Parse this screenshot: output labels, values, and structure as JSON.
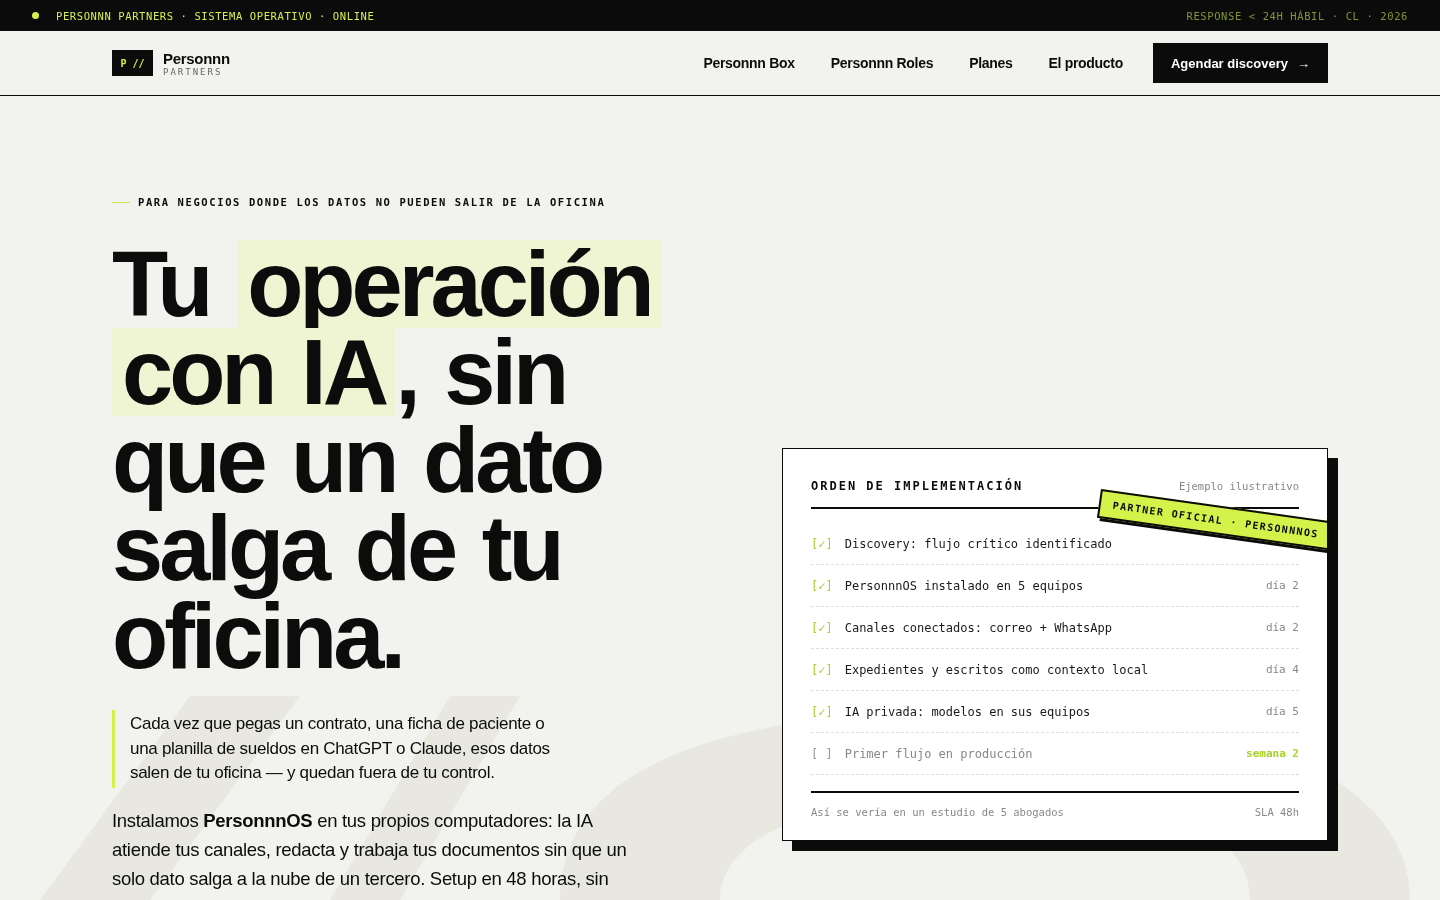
{
  "status_bar": {
    "online": true,
    "left": "PERSONNN PARTNERS · SISTEMA OPERATIVO · ONLINE",
    "right": "RESPONSE < 24H HÁBIL · CL · 2026"
  },
  "nav": {
    "logo_mark": "P //",
    "logo_name": "Personnn",
    "logo_sub": "PARTNERS",
    "links": [
      "Personnn Box",
      "Personnn Roles",
      "Planes",
      "El producto"
    ],
    "cta": {
      "label": "Agendar discovery",
      "arrow": "→"
    }
  },
  "hero": {
    "eyebrow": "PARA NEGOCIOS DONDE LOS DATOS NO PUEDEN SALIR DE LA OFICINA",
    "headline": [
      [
        {
          "text": "Tu ",
          "highlighted": false
        },
        {
          "text": "operación",
          "highlighted": true
        }
      ],
      [
        {
          "text": "con IA",
          "highlighted": true
        },
        {
          "text": ", sin",
          "highlighted": false
        }
      ],
      [
        {
          "text": "que un dato",
          "highlighted": false
        }
      ],
      [
        {
          "text": "salga de tu",
          "highlighted": false
        }
      ],
      [
        {
          "text": "oficina.",
          "highlighted": false
        }
      ]
    ],
    "quote": "Cada vez que pegas un contrato, una ficha de paciente o una planilla de sueldos en ChatGPT o Claude, esos datos salen de tu oficina — y quedan fuera de tu control.",
    "body": "Instalamos **PersonnnOS** en tus propios computadores: la IA atiende tus canales, redacta y trabaja tus documentos sin que un solo dato salga a la nube de un tercero. Setup en 48 horas, sin"
  },
  "card": {
    "title": "ORDEN DE IMPLEMENTACIÓN",
    "note": "Ejemplo ilustrativo",
    "stamp": "PARTNER OFICIAL · PERSONNNOS",
    "rows": [
      {
        "checked": true,
        "mark": "[✓]",
        "text": "Discovery: flujo crítico identificado"
      },
      {
        "checked": true,
        "mark": "[✓]",
        "text": "PersonnnOS instalado en 5 equipos",
        "when": "día 2",
        "highlight": false
      },
      {
        "checked": true,
        "mark": "[✓]",
        "text": "Canales conectados: correo + WhatsApp",
        "when": "día 2",
        "highlight": false
      },
      {
        "checked": true,
        "mark": "[✓]",
        "text": "Expedientes y escritos como contexto local",
        "when": "día 4",
        "highlight": false
      },
      {
        "checked": true,
        "mark": "[✓]",
        "text": "IA privada: modelos en sus equipos",
        "when": "día 5",
        "highlight": false
      },
      {
        "checked": false,
        "mark": "[ ]",
        "text": "Primer flujo en producción",
        "when": "semana 2",
        "highlight": true
      }
    ],
    "footer_left": "Así se vería en un estudio de 5 abogados",
    "footer_right": "SLA 48h"
  }
}
